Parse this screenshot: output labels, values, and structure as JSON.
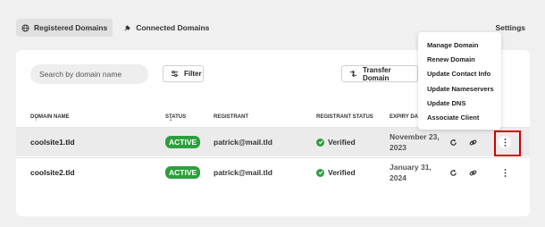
{
  "tabs": [
    {
      "label": "Registered Domains",
      "icon": "globe-icon",
      "active": true
    },
    {
      "label": "Connected Domains",
      "icon": "plug-icon",
      "active": false
    }
  ],
  "settings_label": "Settings",
  "search": {
    "placeholder": "Search by domain name"
  },
  "filter_label": "Filter",
  "transfer_label": "Transfer Domain",
  "table": {
    "headers": {
      "domain": "DOMAIN NAME",
      "status": "STATUS",
      "registrant": "REGISTRANT",
      "registrant_status": "REGISTRANT STATUS",
      "expiry": "EXPIRY DAT"
    },
    "rows": [
      {
        "domain": "coolsite1.tld",
        "status": "ACTIVE",
        "registrant": "patrick@mail.tld",
        "registrant_status": "Verified",
        "expiry": "November 23, 2023"
      },
      {
        "domain": "coolsite2.tld",
        "status": "ACTIVE",
        "registrant": "patrick@mail.tld",
        "registrant_status": "Verified",
        "expiry": "January 31, 2024"
      }
    ]
  },
  "menu": {
    "items": [
      "Manage Domain",
      "Renew Domain",
      "Update Contact Info",
      "Update Nameservers",
      "Update DNS",
      "Associate Client"
    ]
  },
  "colors": {
    "active_badge": "#2e9e3e",
    "highlight_box": "#d00000"
  }
}
